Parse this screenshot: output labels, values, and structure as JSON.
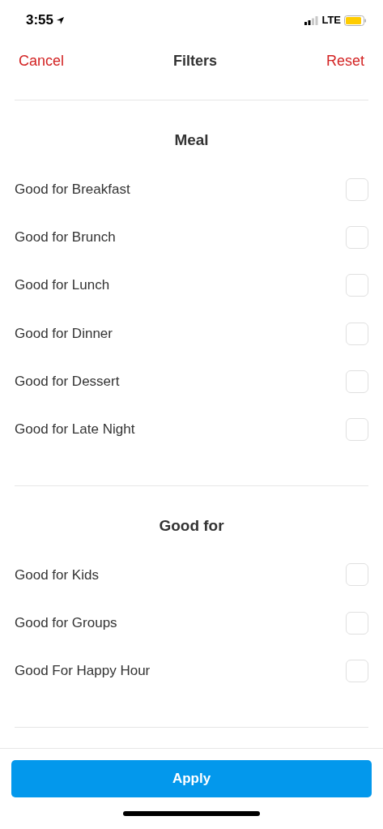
{
  "status_bar": {
    "time": "3:55",
    "network": "LTE"
  },
  "nav": {
    "cancel": "Cancel",
    "title": "Filters",
    "reset": "Reset"
  },
  "sections": [
    {
      "title": "Meal",
      "options": [
        {
          "label": "Good for Breakfast",
          "checked": false
        },
        {
          "label": "Good for Brunch",
          "checked": false
        },
        {
          "label": "Good for Lunch",
          "checked": false
        },
        {
          "label": "Good for Dinner",
          "checked": false
        },
        {
          "label": "Good for Dessert",
          "checked": false
        },
        {
          "label": "Good for Late Night",
          "checked": false
        }
      ]
    },
    {
      "title": "Good for",
      "options": [
        {
          "label": "Good for Kids",
          "checked": false
        },
        {
          "label": "Good for Groups",
          "checked": false
        },
        {
          "label": "Good For Happy Hour",
          "checked": false
        }
      ]
    }
  ],
  "apply_button": "Apply"
}
